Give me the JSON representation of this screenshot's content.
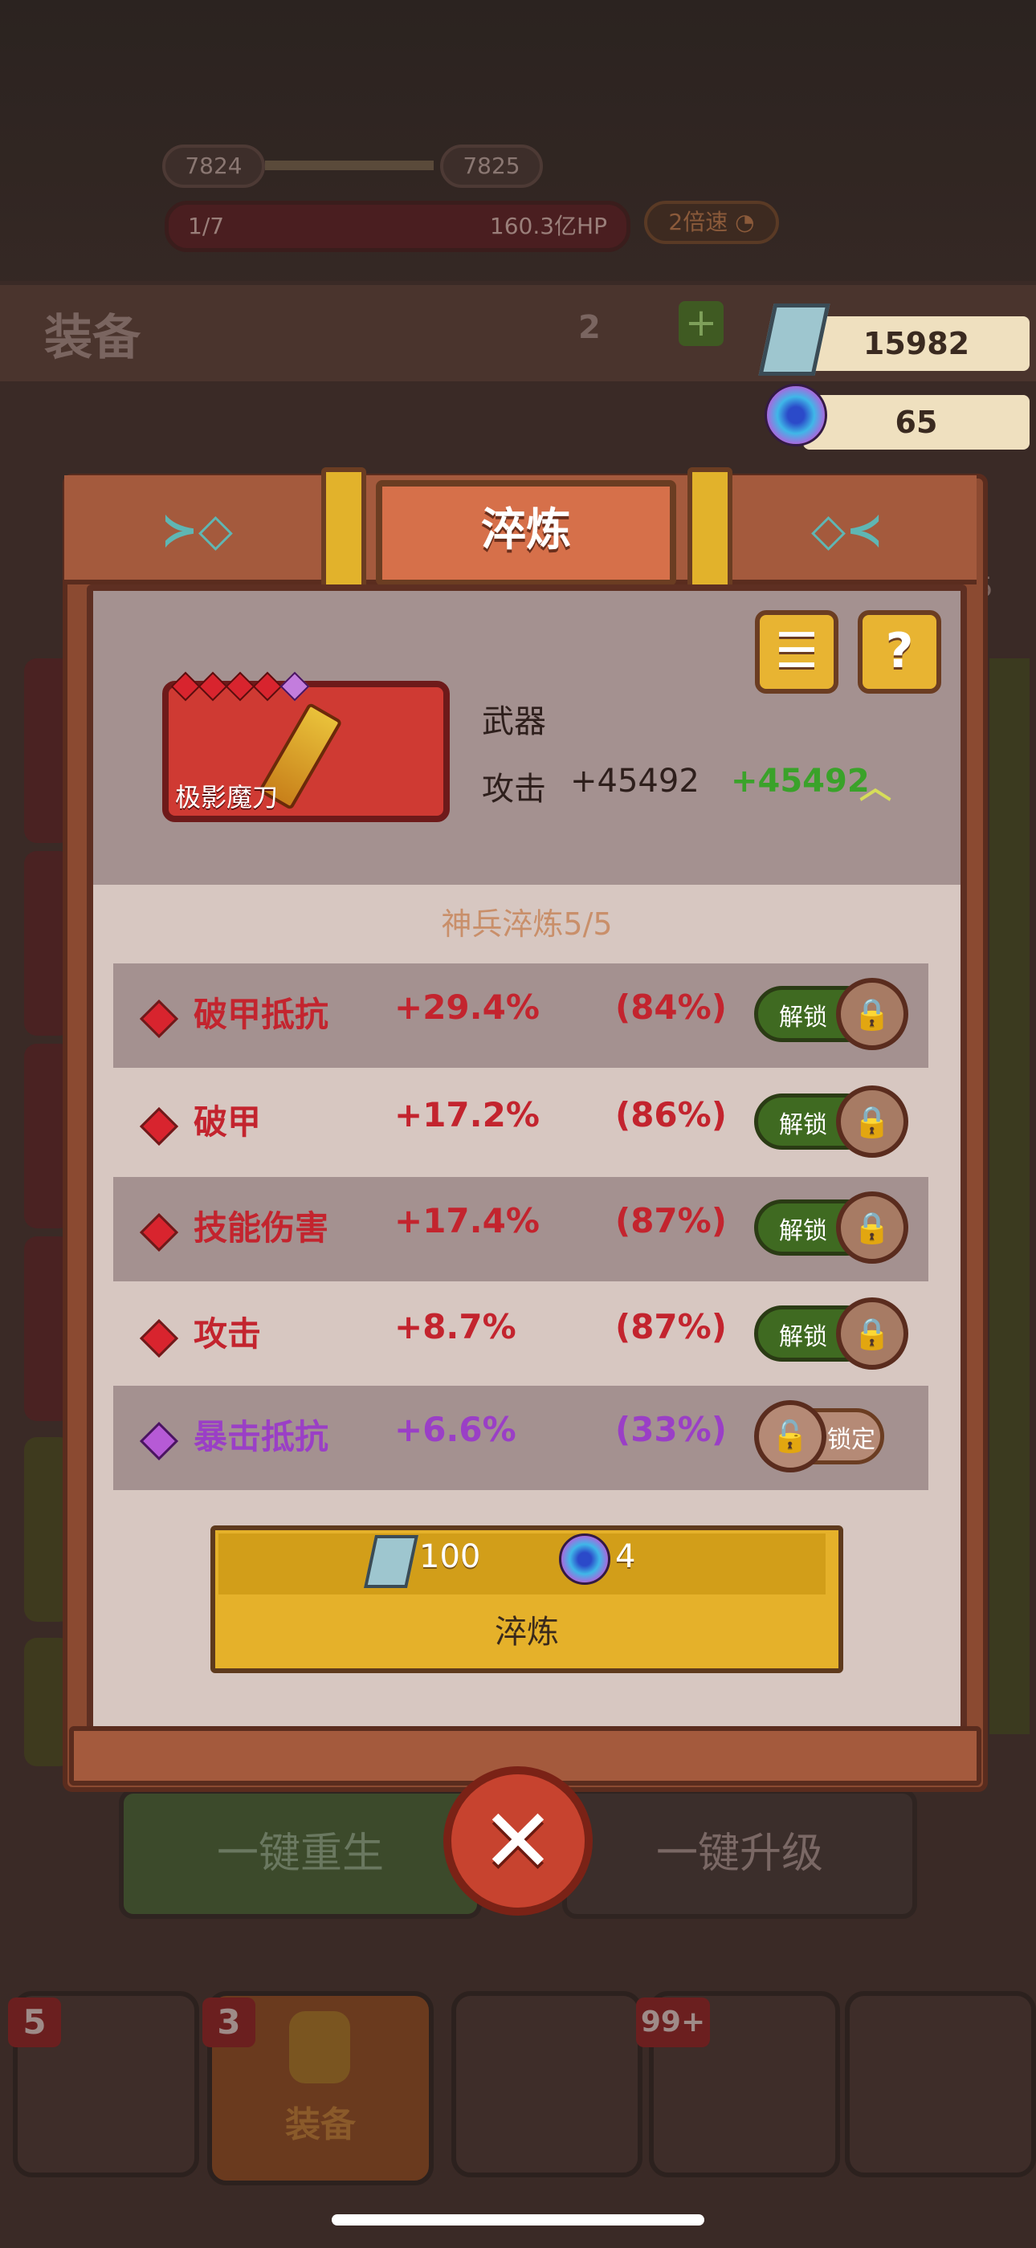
{
  "background": {
    "score_left": "7824",
    "score_right": "7825",
    "wave": "1/7",
    "hp": "160.3亿HP",
    "speed": "2倍速",
    "panel_title": "装备",
    "level": "2",
    "side_number": "5",
    "rebirth_button": "一键重生",
    "upgrade_button": "一键升级",
    "tabs": [
      {
        "badge": "5",
        "label": ""
      },
      {
        "badge": "3",
        "label": "装备"
      },
      {
        "badge": "",
        "label": ""
      },
      {
        "badge": "99+",
        "label": ""
      },
      {
        "badge": "",
        "label": ""
      }
    ]
  },
  "currency": {
    "crystal": "15982",
    "orb": "65"
  },
  "dialog": {
    "title": "淬炼",
    "item": {
      "name": "极影魔刀",
      "type": "武器",
      "stat_label": "攻击",
      "stat_value": "+45492",
      "stat_bonus": "+45492"
    },
    "section_title": "神兵淬炼5/5",
    "rows": [
      {
        "name": "破甲抵抗",
        "value": "+29.4%",
        "percent": "(84%)",
        "button": "解锁",
        "state": "unlock"
      },
      {
        "name": "破甲",
        "value": "+17.2%",
        "percent": "(86%)",
        "button": "解锁",
        "state": "unlock"
      },
      {
        "name": "技能伤害",
        "value": "+17.4%",
        "percent": "(87%)",
        "button": "解锁",
        "state": "unlock"
      },
      {
        "name": "攻击",
        "value": "+8.7%",
        "percent": "(87%)",
        "button": "解锁",
        "state": "unlock"
      },
      {
        "name": "暴击抵抗",
        "value": "+6.6%",
        "percent": "(33%)",
        "button": "锁定",
        "state": "lock"
      }
    ],
    "cost": {
      "crystal": "100",
      "orb": "4"
    },
    "refine_button": "淬炼"
  },
  "colors": {
    "red_stat": "#c3242e",
    "purple_stat": "#9a3fc6",
    "green_bonus": "#3aa22a",
    "button_gold": "#e5b12a"
  }
}
